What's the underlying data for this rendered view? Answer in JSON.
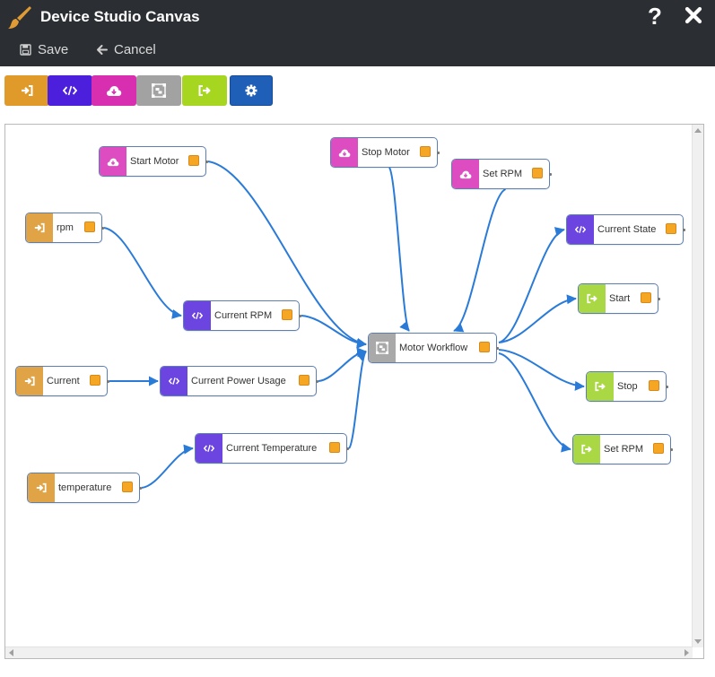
{
  "window": {
    "title": "Device Studio Canvas",
    "help_glyph": "?"
  },
  "menu": {
    "save_label": "Save",
    "cancel_label": "Cancel"
  },
  "toolbar": [
    {
      "icon": "sign-in-icon",
      "color": "#df9a2a"
    },
    {
      "icon": "code-icon",
      "color": "#4b1fdb"
    },
    {
      "icon": "cloud-download-icon",
      "color": "#d82fb0"
    },
    {
      "icon": "workflow-icon",
      "color": "#a2a2a2"
    },
    {
      "icon": "sign-out-icon",
      "color": "#a6d61f"
    },
    {
      "icon": "gear-icon",
      "color": "#1f5fb8"
    }
  ],
  "colors": {
    "input": "#e0a446",
    "transform": "#6c44e0",
    "command": "#dd4cc0",
    "workflow": "#a9a9a9",
    "output": "#a9d844",
    "status": "#f5a623",
    "edge": "#2a7bd8"
  },
  "nodes": [
    {
      "id": "start_motor",
      "label": "Start Motor",
      "type": "command"
    },
    {
      "id": "stop_motor",
      "label": "Stop Motor",
      "type": "command"
    },
    {
      "id": "set_rpm_cmd",
      "label": "Set RPM",
      "type": "command"
    },
    {
      "id": "rpm",
      "label": "rpm",
      "type": "input"
    },
    {
      "id": "current_rpm",
      "label": "Current RPM",
      "type": "transform"
    },
    {
      "id": "current",
      "label": "Current",
      "type": "input"
    },
    {
      "id": "current_power",
      "label": "Current Power Usage",
      "type": "transform"
    },
    {
      "id": "current_temp",
      "label": "Current Temperature",
      "type": "transform"
    },
    {
      "id": "temperature",
      "label": "temperature",
      "type": "input"
    },
    {
      "id": "motor_workflow",
      "label": "Motor Workflow",
      "type": "workflow"
    },
    {
      "id": "current_state",
      "label": "Current State",
      "type": "transform"
    },
    {
      "id": "start_out",
      "label": "Start",
      "type": "output"
    },
    {
      "id": "stop_out",
      "label": "Stop",
      "type": "output"
    },
    {
      "id": "set_rpm_out",
      "label": "Set RPM",
      "type": "output"
    }
  ],
  "edges": [
    {
      "from": "start_motor",
      "to": "motor_workflow"
    },
    {
      "from": "stop_motor",
      "to": "motor_workflow"
    },
    {
      "from": "set_rpm_cmd",
      "to": "motor_workflow"
    },
    {
      "from": "rpm",
      "to": "current_rpm"
    },
    {
      "from": "current_rpm",
      "to": "motor_workflow"
    },
    {
      "from": "current",
      "to": "current_power"
    },
    {
      "from": "current_power",
      "to": "motor_workflow"
    },
    {
      "from": "temperature",
      "to": "current_temp"
    },
    {
      "from": "current_temp",
      "to": "motor_workflow"
    },
    {
      "from": "motor_workflow",
      "to": "current_state"
    },
    {
      "from": "motor_workflow",
      "to": "start_out"
    },
    {
      "from": "motor_workflow",
      "to": "stop_out"
    },
    {
      "from": "motor_workflow",
      "to": "set_rpm_out"
    }
  ]
}
